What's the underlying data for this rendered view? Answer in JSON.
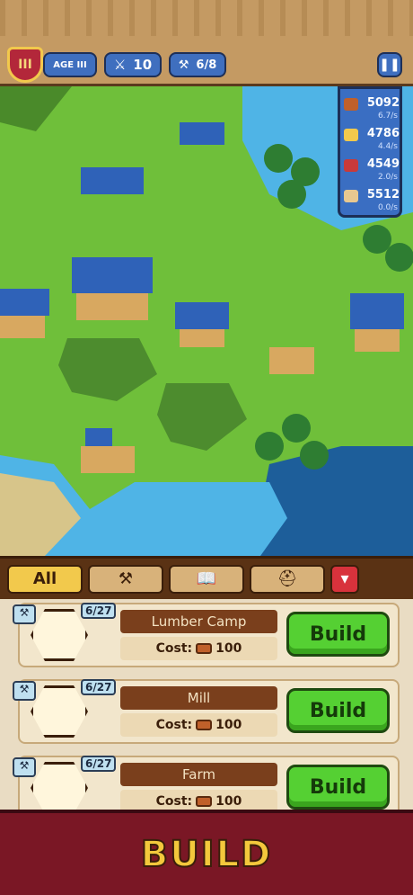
{
  "hud": {
    "age_numeral": "III",
    "age_label": "AGE III",
    "military": "10",
    "builders": "6/8"
  },
  "resources": [
    {
      "name": "wood-icon",
      "color": "#c0602a",
      "value": "5092",
      "rate": "6.7/s"
    },
    {
      "name": "gold-icon",
      "color": "#f2c94c",
      "value": "4786",
      "rate": "4.4/s"
    },
    {
      "name": "meat-icon",
      "color": "#c83a3a",
      "value": "4549",
      "rate": "2.0/s"
    },
    {
      "name": "scroll-icon",
      "color": "#e8c890",
      "value": "5512",
      "rate": "0.0/s"
    }
  ],
  "tabs": {
    "all_label": "All"
  },
  "buildings": [
    {
      "name": "Lumber Camp",
      "count": "6/27",
      "cost_label": "Cost:",
      "cost": "100",
      "button": "Build"
    },
    {
      "name": "Mill",
      "count": "6/27",
      "cost_label": "Cost:",
      "cost": "100",
      "button": "Build"
    },
    {
      "name": "Farm",
      "count": "6/27",
      "cost_label": "Cost:",
      "cost": "100",
      "button": "Build"
    }
  ],
  "footer": {
    "label": "BUILD"
  }
}
